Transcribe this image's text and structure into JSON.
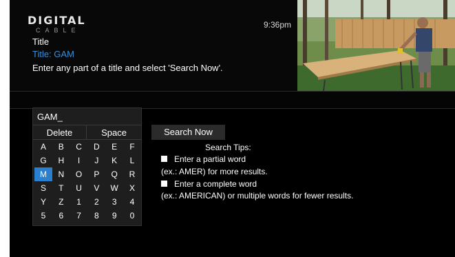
{
  "header": {
    "logo_main": "DIGITAL",
    "logo_sub": "CABLE",
    "time": "9:36pm",
    "title_label": "Title",
    "title_value": "Title: GAM",
    "instruction": "Enter any part of a title and select 'Search Now'."
  },
  "keyboard": {
    "input_text": "GAM_",
    "delete_label": "Delete",
    "space_label": "Space",
    "selected_key": "M",
    "rows": [
      [
        "A",
        "B",
        "C",
        "D",
        "E",
        "F"
      ],
      [
        "G",
        "H",
        "I",
        "J",
        "K",
        "L"
      ],
      [
        "M",
        "N",
        "O",
        "P",
        "Q",
        "R"
      ],
      [
        "S",
        "T",
        "U",
        "V",
        "W",
        "X"
      ],
      [
        "Y",
        "Z",
        "1",
        "2",
        "3",
        "4"
      ],
      [
        "5",
        "6",
        "7",
        "8",
        "9",
        "0"
      ]
    ]
  },
  "search": {
    "button_label": "Search Now",
    "tips_heading": "Search Tips:",
    "tip1": "Enter a partial word",
    "tip1_example": "(ex.: AMER) for more results.",
    "tip2": "Enter a complete word",
    "tip2_example": "(ex.: AMERICAN) or multiple words for fewer results."
  },
  "colors": {
    "accent": "#2a7fcf",
    "title_value": "#3a8fd8",
    "background": "#000000",
    "keyboard_bg": "#1e1e1e"
  },
  "icons": [
    "checkbox-icon"
  ]
}
